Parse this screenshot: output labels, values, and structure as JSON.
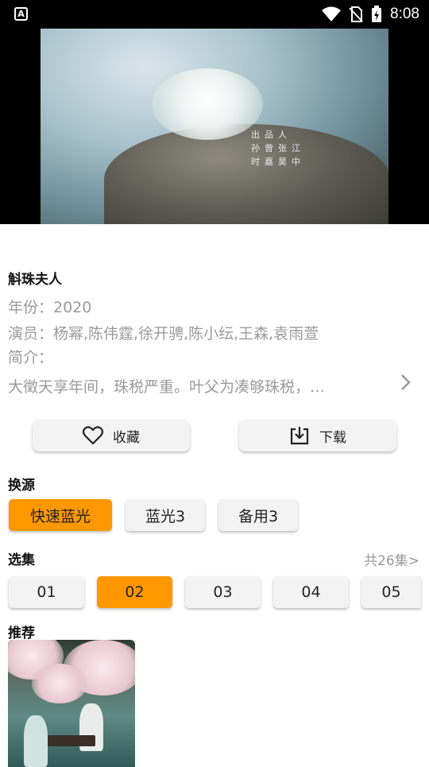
{
  "status_bar": {
    "app_badge": "A",
    "time": "8:08"
  },
  "video": {
    "credits": [
      "出品人",
      "孙曾张江",
      "时嘉昊中"
    ]
  },
  "detail": {
    "title": "斛珠夫人",
    "year_line": "年份：2020",
    "cast_line": "演员：杨幂,陈伟霆,徐开骋,陈小纭,王森,袁雨萱",
    "intro_label": "简介：",
    "intro_text": "大徵天享年间，珠税严重。叶父为凑够珠税，…"
  },
  "actions": {
    "favorite_label": "收藏",
    "download_label": "下载"
  },
  "source": {
    "heading": "换源",
    "options": [
      "快速蓝光",
      "蓝光3",
      "备用3"
    ],
    "selected_index": 0
  },
  "episodes": {
    "heading": "选集",
    "total_label": "共26集>",
    "items": [
      "01",
      "02",
      "03",
      "04",
      "05"
    ],
    "selected_index": 1
  },
  "recommend": {
    "heading": "推荐"
  },
  "colors": {
    "accent": "#ff9800",
    "chip_bg": "#f3f3f3",
    "muted_text": "#9a9a9a"
  }
}
